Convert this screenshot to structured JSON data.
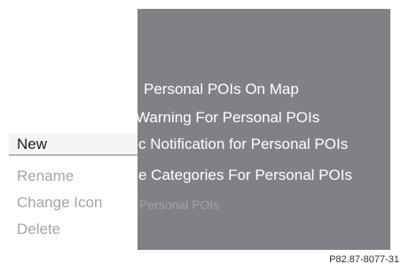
{
  "background_menu": {
    "items": [
      {
        "label": "Personal POIs On Map",
        "dim": false
      },
      {
        "label": "Warning For Personal POIs",
        "dim": false
      },
      {
        "label": "c Notification for Personal POIs",
        "dim": false
      },
      {
        "label": "e Categories For Personal POIs",
        "dim": false
      },
      {
        "label": "Personal POIs",
        "dim": true
      }
    ]
  },
  "submenu": {
    "items": [
      {
        "label": "New",
        "active": true
      },
      {
        "label": "Rename",
        "active": false
      },
      {
        "label": "Change Icon",
        "active": false
      },
      {
        "label": "Delete",
        "active": false
      }
    ]
  },
  "caption": "P82.87-8077-31"
}
